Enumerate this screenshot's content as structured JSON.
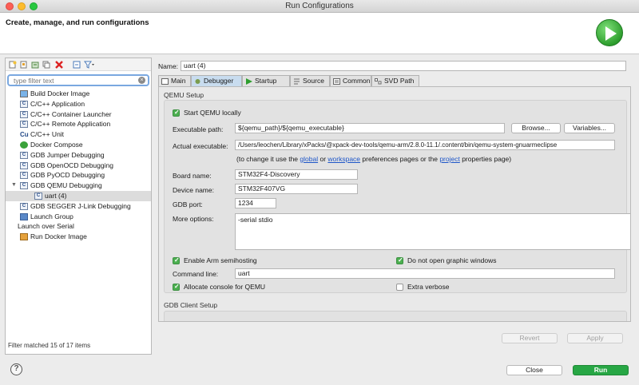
{
  "window": {
    "title": "Run Configurations"
  },
  "header": {
    "heading": "Create, manage, and run configurations"
  },
  "left": {
    "filter_placeholder": "type filter text",
    "items": [
      {
        "label": "Build Docker Image"
      },
      {
        "label": "C/C++ Application"
      },
      {
        "label": "C/C++ Container Launcher"
      },
      {
        "label": "C/C++ Remote Application"
      },
      {
        "label": "C/C++ Unit"
      },
      {
        "label": "Docker Compose"
      },
      {
        "label": "GDB Jumper Debugging"
      },
      {
        "label": "GDB OpenOCD Debugging"
      },
      {
        "label": "GDB PyOCD Debugging"
      },
      {
        "label": "GDB QEMU Debugging"
      },
      {
        "label": "uart (4)"
      },
      {
        "label": "GDB SEGGER J-Link Debugging"
      },
      {
        "label": "Launch Group"
      },
      {
        "label": "Launch over Serial"
      },
      {
        "label": "Run Docker Image"
      }
    ],
    "status": "Filter matched 15 of 17 items"
  },
  "config": {
    "name_label": "Name:",
    "name_value": "uart (4)",
    "tabs": [
      {
        "label": "Main"
      },
      {
        "label": "Debugger"
      },
      {
        "label": "Startup"
      },
      {
        "label": "Source"
      },
      {
        "label": "Common"
      },
      {
        "label": "SVD Path"
      }
    ],
    "qemu": {
      "title": "QEMU Setup",
      "start_locally": "Start QEMU locally",
      "exe_label": "Executable path:",
      "exe_value": "${qemu_path}/${qemu_executable}",
      "browse": "Browse...",
      "variables": "Variables...",
      "actual_label": "Actual executable:",
      "actual_value": "/Users/leochen/Library/xPacks/@xpack-dev-tools/qemu-arm/2.8.0-11.1/.content/bin/qemu-system-gnuarmeclipse",
      "hint_pre": "(to change it use the",
      "hint_global": "global",
      "hint_or": "or",
      "hint_workspace": "workspace",
      "hint_mid": "preferences pages or the",
      "hint_project": "project",
      "hint_post": "properties page)",
      "board_label": "Board name:",
      "board_value": "STM32F4-Discovery",
      "device_label": "Device name:",
      "device_value": "STM32F407VG",
      "gdbport_label": "GDB port:",
      "gdbport_value": "1234",
      "more_label": "More options:",
      "more_value": "-serial stdio",
      "semihosting": "Enable Arm semihosting",
      "no_graphic": "Do not open graphic windows",
      "cmdline_label": "Command line:",
      "cmdline_value": "uart",
      "alloc_console": "Allocate console for QEMU",
      "extra_verbose": "Extra verbose"
    },
    "gdb_client_title": "GDB Client Setup",
    "revert": "Revert",
    "apply": "Apply"
  },
  "footer": {
    "close": "Close",
    "run": "Run"
  },
  "colors": {
    "run_green": "#28a745",
    "tab_active": "#c8dcef",
    "filter_border": "#7aa8e0"
  }
}
